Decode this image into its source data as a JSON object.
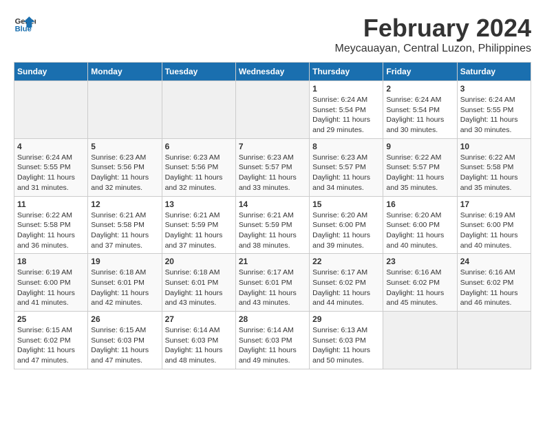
{
  "logo": {
    "line1": "General",
    "line2": "Blue"
  },
  "title": "February 2024",
  "subtitle": "Meycauayan, Central Luzon, Philippines",
  "headers": [
    "Sunday",
    "Monday",
    "Tuesday",
    "Wednesday",
    "Thursday",
    "Friday",
    "Saturday"
  ],
  "weeks": [
    [
      {
        "day": "",
        "info": ""
      },
      {
        "day": "",
        "info": ""
      },
      {
        "day": "",
        "info": ""
      },
      {
        "day": "",
        "info": ""
      },
      {
        "day": "1",
        "info": "Sunrise: 6:24 AM\nSunset: 5:54 PM\nDaylight: 11 hours\nand 29 minutes."
      },
      {
        "day": "2",
        "info": "Sunrise: 6:24 AM\nSunset: 5:54 PM\nDaylight: 11 hours\nand 30 minutes."
      },
      {
        "day": "3",
        "info": "Sunrise: 6:24 AM\nSunset: 5:55 PM\nDaylight: 11 hours\nand 30 minutes."
      }
    ],
    [
      {
        "day": "4",
        "info": "Sunrise: 6:24 AM\nSunset: 5:55 PM\nDaylight: 11 hours\nand 31 minutes."
      },
      {
        "day": "5",
        "info": "Sunrise: 6:23 AM\nSunset: 5:56 PM\nDaylight: 11 hours\nand 32 minutes."
      },
      {
        "day": "6",
        "info": "Sunrise: 6:23 AM\nSunset: 5:56 PM\nDaylight: 11 hours\nand 32 minutes."
      },
      {
        "day": "7",
        "info": "Sunrise: 6:23 AM\nSunset: 5:57 PM\nDaylight: 11 hours\nand 33 minutes."
      },
      {
        "day": "8",
        "info": "Sunrise: 6:23 AM\nSunset: 5:57 PM\nDaylight: 11 hours\nand 34 minutes."
      },
      {
        "day": "9",
        "info": "Sunrise: 6:22 AM\nSunset: 5:57 PM\nDaylight: 11 hours\nand 35 minutes."
      },
      {
        "day": "10",
        "info": "Sunrise: 6:22 AM\nSunset: 5:58 PM\nDaylight: 11 hours\nand 35 minutes."
      }
    ],
    [
      {
        "day": "11",
        "info": "Sunrise: 6:22 AM\nSunset: 5:58 PM\nDaylight: 11 hours\nand 36 minutes."
      },
      {
        "day": "12",
        "info": "Sunrise: 6:21 AM\nSunset: 5:58 PM\nDaylight: 11 hours\nand 37 minutes."
      },
      {
        "day": "13",
        "info": "Sunrise: 6:21 AM\nSunset: 5:59 PM\nDaylight: 11 hours\nand 37 minutes."
      },
      {
        "day": "14",
        "info": "Sunrise: 6:21 AM\nSunset: 5:59 PM\nDaylight: 11 hours\nand 38 minutes."
      },
      {
        "day": "15",
        "info": "Sunrise: 6:20 AM\nSunset: 6:00 PM\nDaylight: 11 hours\nand 39 minutes."
      },
      {
        "day": "16",
        "info": "Sunrise: 6:20 AM\nSunset: 6:00 PM\nDaylight: 11 hours\nand 40 minutes."
      },
      {
        "day": "17",
        "info": "Sunrise: 6:19 AM\nSunset: 6:00 PM\nDaylight: 11 hours\nand 40 minutes."
      }
    ],
    [
      {
        "day": "18",
        "info": "Sunrise: 6:19 AM\nSunset: 6:00 PM\nDaylight: 11 hours\nand 41 minutes."
      },
      {
        "day": "19",
        "info": "Sunrise: 6:18 AM\nSunset: 6:01 PM\nDaylight: 11 hours\nand 42 minutes."
      },
      {
        "day": "20",
        "info": "Sunrise: 6:18 AM\nSunset: 6:01 PM\nDaylight: 11 hours\nand 43 minutes."
      },
      {
        "day": "21",
        "info": "Sunrise: 6:17 AM\nSunset: 6:01 PM\nDaylight: 11 hours\nand 43 minutes."
      },
      {
        "day": "22",
        "info": "Sunrise: 6:17 AM\nSunset: 6:02 PM\nDaylight: 11 hours\nand 44 minutes."
      },
      {
        "day": "23",
        "info": "Sunrise: 6:16 AM\nSunset: 6:02 PM\nDaylight: 11 hours\nand 45 minutes."
      },
      {
        "day": "24",
        "info": "Sunrise: 6:16 AM\nSunset: 6:02 PM\nDaylight: 11 hours\nand 46 minutes."
      }
    ],
    [
      {
        "day": "25",
        "info": "Sunrise: 6:15 AM\nSunset: 6:02 PM\nDaylight: 11 hours\nand 47 minutes."
      },
      {
        "day": "26",
        "info": "Sunrise: 6:15 AM\nSunset: 6:03 PM\nDaylight: 11 hours\nand 47 minutes."
      },
      {
        "day": "27",
        "info": "Sunrise: 6:14 AM\nSunset: 6:03 PM\nDaylight: 11 hours\nand 48 minutes."
      },
      {
        "day": "28",
        "info": "Sunrise: 6:14 AM\nSunset: 6:03 PM\nDaylight: 11 hours\nand 49 minutes."
      },
      {
        "day": "29",
        "info": "Sunrise: 6:13 AM\nSunset: 6:03 PM\nDaylight: 11 hours\nand 50 minutes."
      },
      {
        "day": "",
        "info": ""
      },
      {
        "day": "",
        "info": ""
      }
    ]
  ]
}
